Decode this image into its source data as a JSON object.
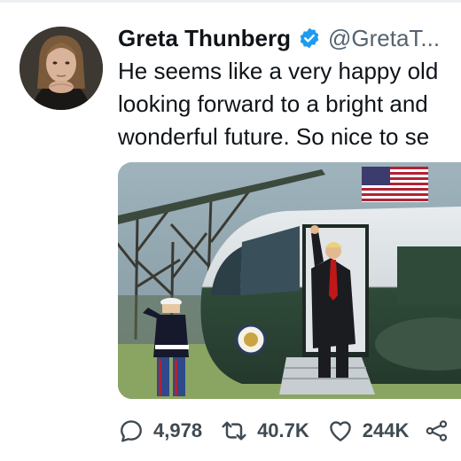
{
  "tweet": {
    "display_name": "Greta Thunberg",
    "verified_badge": "verified-check-icon",
    "handle": "@GretaT...",
    "text_lines": [
      "He seems like a very happy old",
      "looking forward to a bright and",
      "wonderful future. So nice to se"
    ],
    "media_image": "photo-of-man-saluting-from-helicopter-stairs"
  },
  "actions": {
    "reply_count": "4,978",
    "retweet_count": "40.7K",
    "like_count": "244K",
    "share_icon": "share-icon"
  },
  "colors": {
    "verified_blue": "#1d9bf0",
    "text_primary": "#0f1419",
    "text_secondary": "#536471",
    "action_gray": "#3f4a52"
  }
}
